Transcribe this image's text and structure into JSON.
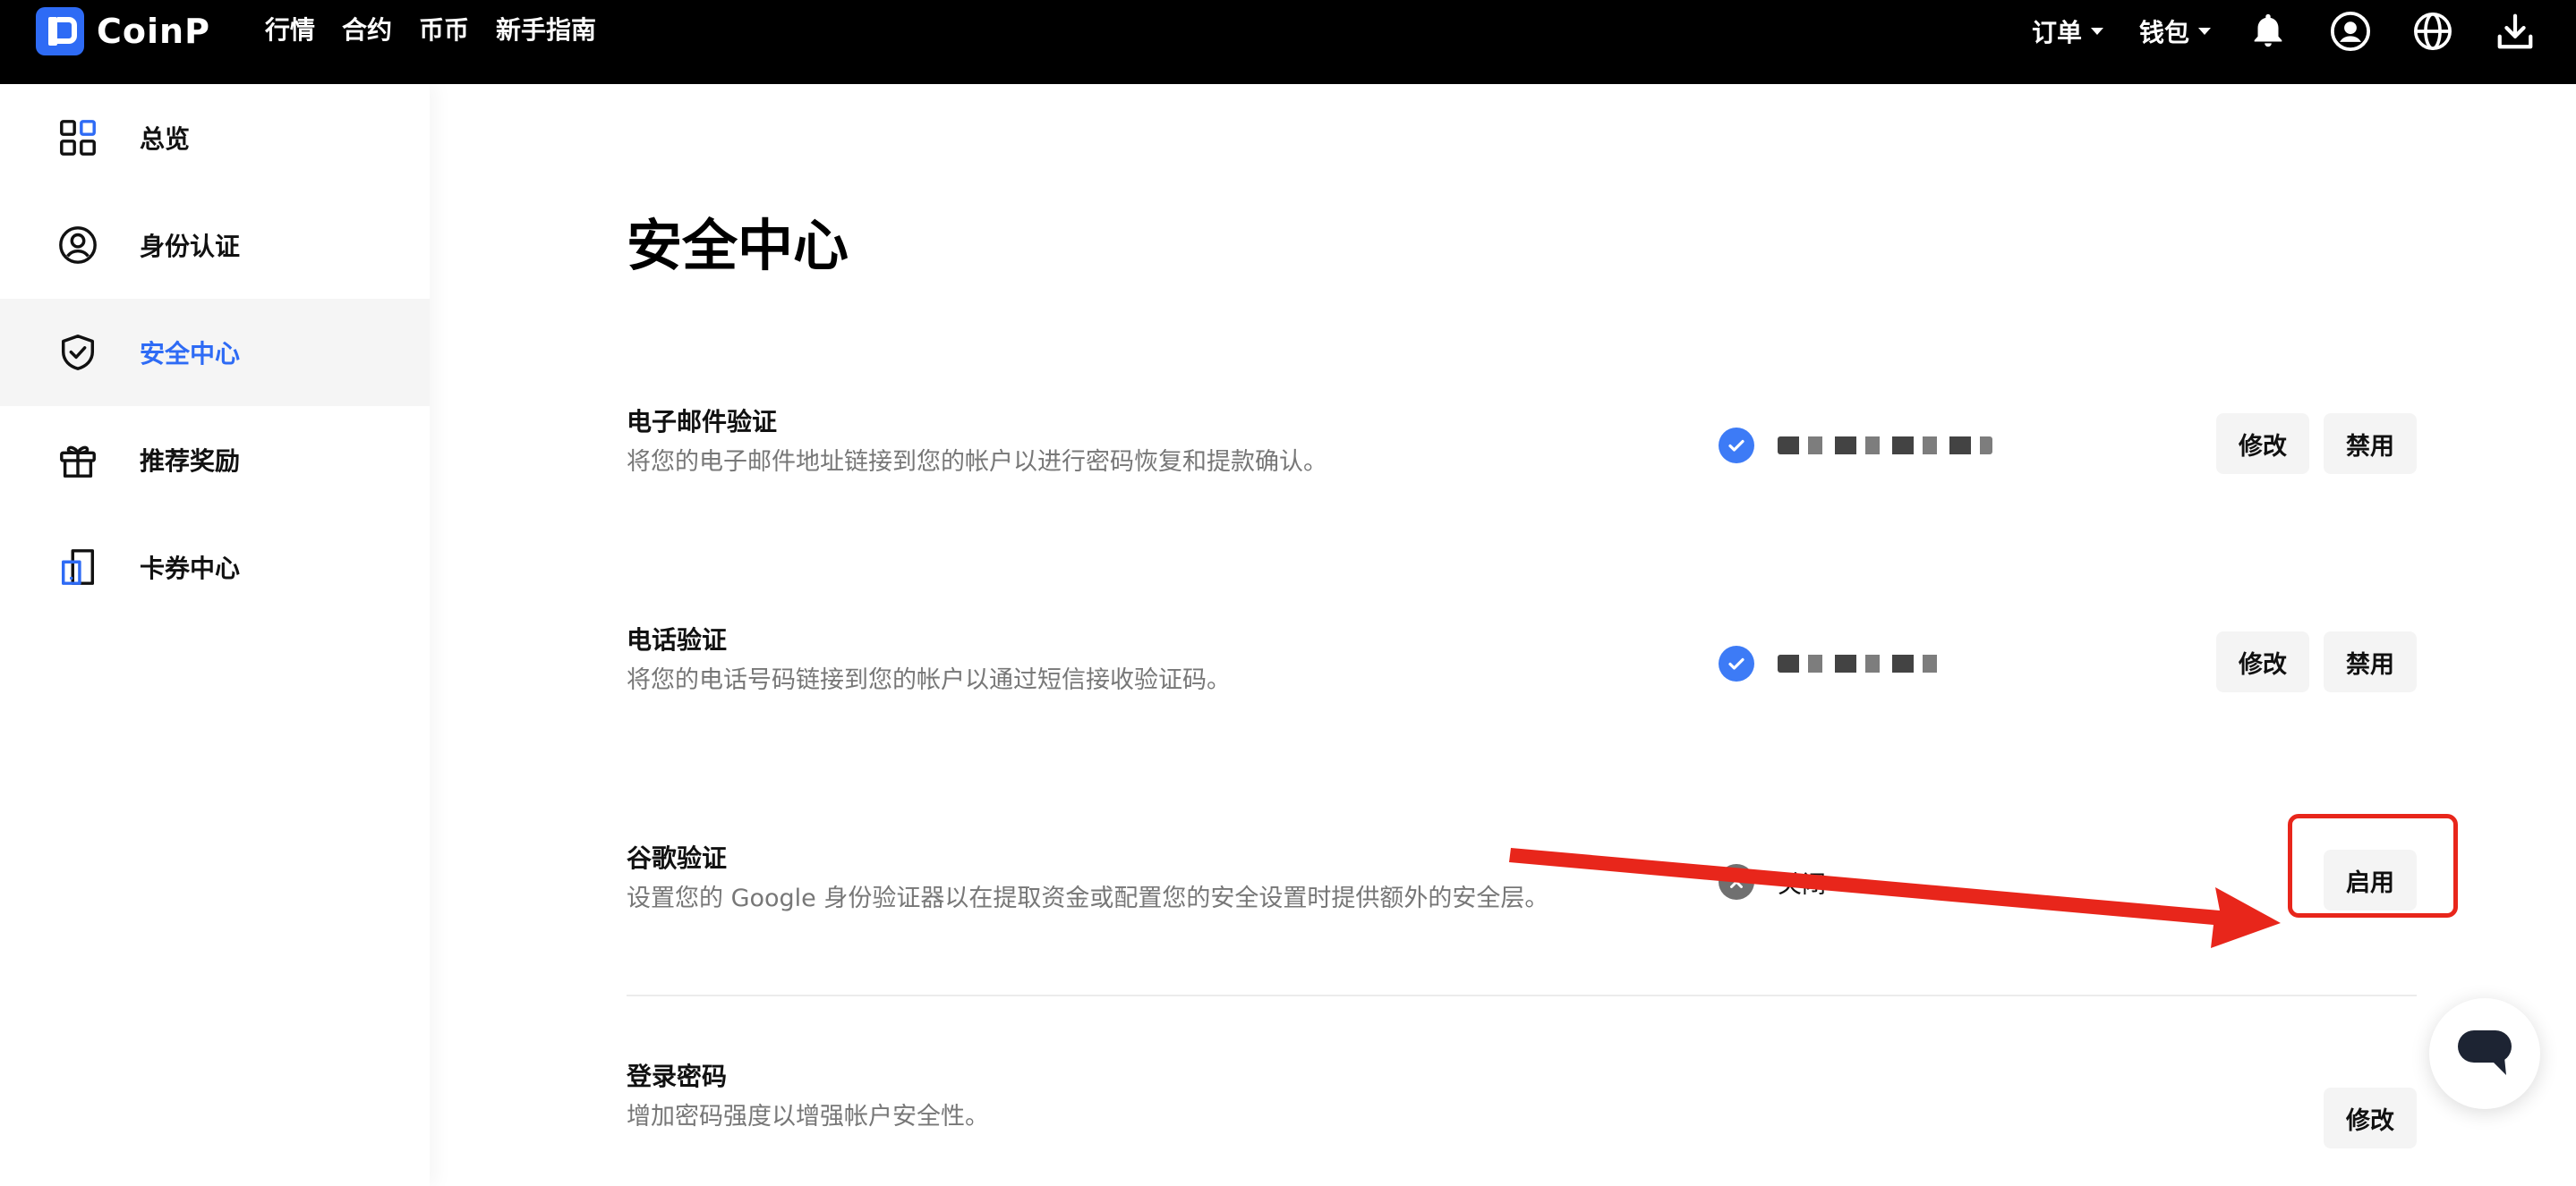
{
  "brand": {
    "name": "CoinP",
    "color": "#2e6bf5"
  },
  "nav": [
    "行情",
    "合约",
    "币币",
    "新手指南"
  ],
  "topbar_right": {
    "orders": "订单",
    "wallet": "钱包"
  },
  "sidebar": {
    "items": [
      {
        "label": "总览",
        "icon": "grid-icon"
      },
      {
        "label": "身份认证",
        "icon": "user-circle-icon"
      },
      {
        "label": "安全中心",
        "icon": "shield-check-icon",
        "active": true
      },
      {
        "label": "推荐奖励",
        "icon": "gift-icon"
      },
      {
        "label": "卡券中心",
        "icon": "card-icon"
      }
    ]
  },
  "page": {
    "title": "安全中心"
  },
  "security": {
    "email": {
      "title": "电子邮件验证",
      "desc": "将您的电子邮件地址链接到您的帐户以进行密码恢复和提款确认。",
      "status": "verified",
      "edit": "修改",
      "disable": "禁用"
    },
    "phone": {
      "title": "电话验证",
      "desc": "将您的电话号码链接到您的帐户以通过短信接收验证码。",
      "status": "verified",
      "edit": "修改",
      "disable": "禁用"
    },
    "google": {
      "title": "谷歌验证",
      "desc": "设置您的 Google 身份验证器以在提取资金或配置您的安全设置时提供额外的安全层。",
      "status_text": "关闭",
      "enable": "启用"
    },
    "password": {
      "title": "登录密码",
      "desc": "增加密码强度以增强帐户安全性。",
      "edit": "修改"
    }
  },
  "colors": {
    "accent": "#2e6bf5",
    "annotation_red": "#e8261b",
    "verified_blue": "#3d7bf6"
  }
}
